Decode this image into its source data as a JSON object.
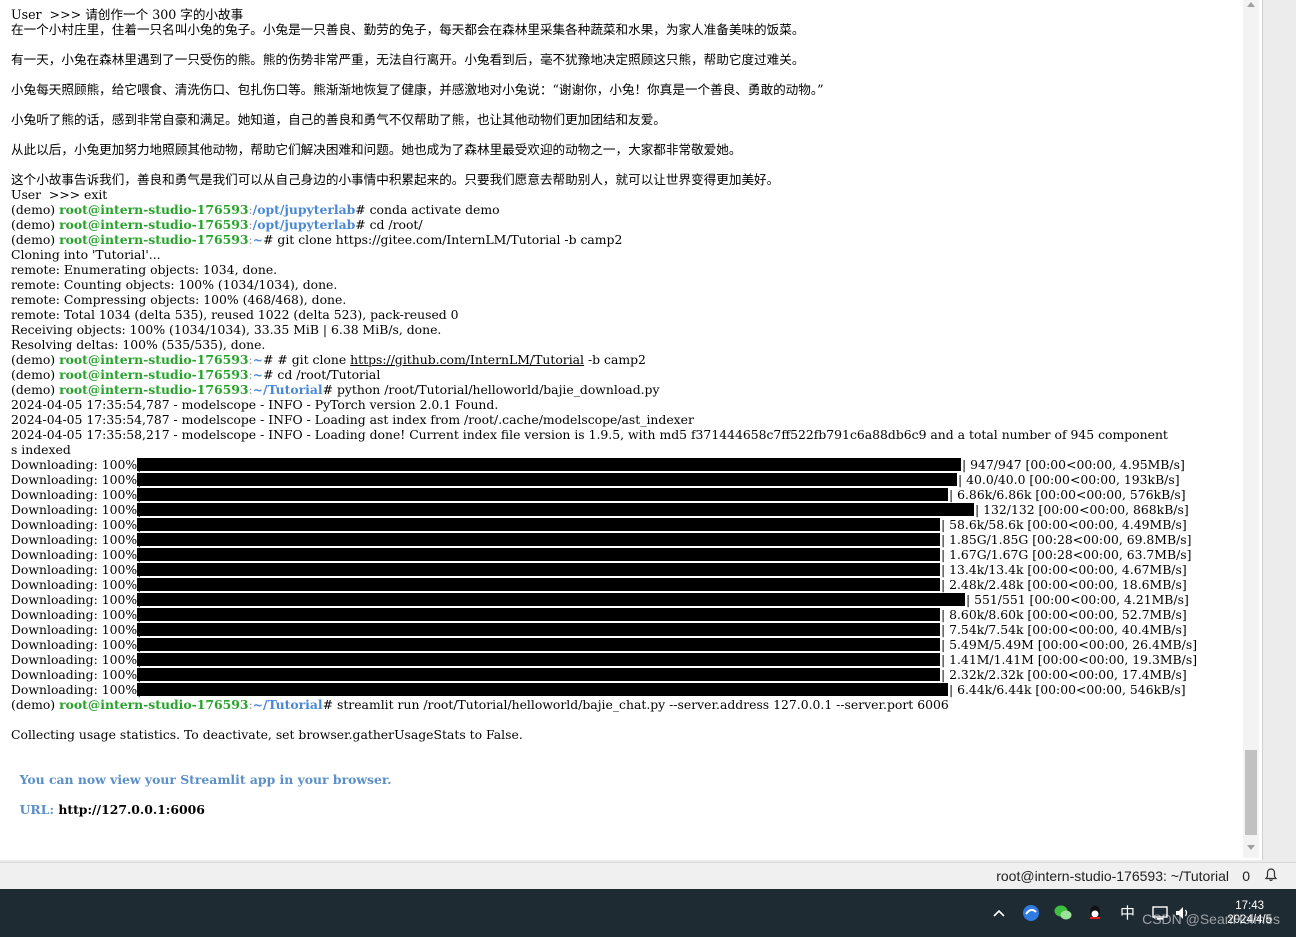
{
  "terminal": {
    "lines": [
      {
        "t": "plain",
        "text": "User  >>> 请创作一个 300 字的小故事"
      },
      {
        "t": "plain",
        "text": "在一个小村庄里，住着一只名叫小兔的兔子。小兔是一只善良、勤劳的兔子，每天都会在森林里采集各种蔬菜和水果，为家人准备美味的饭菜。"
      },
      {
        "t": "plain",
        "text": ""
      },
      {
        "t": "plain",
        "text": "有一天，小兔在森林里遇到了一只受伤的熊。熊的伤势非常严重，无法自行离开。小兔看到后，毫不犹豫地决定照顾这只熊，帮助它度过难关。"
      },
      {
        "t": "plain",
        "text": ""
      },
      {
        "t": "plain",
        "text": "小兔每天照顾熊，给它喂食、清洗伤口、包扎伤口等。熊渐渐地恢复了健康，并感激地对小兔说：“谢谢你，小兔！你真是一个善良、勇敢的动物。”"
      },
      {
        "t": "plain",
        "text": ""
      },
      {
        "t": "plain",
        "text": "小兔听了熊的话，感到非常自豪和满足。她知道，自己的善良和勇气不仅帮助了熊，也让其他动物们更加团结和友爱。"
      },
      {
        "t": "plain",
        "text": ""
      },
      {
        "t": "plain",
        "text": "从此以后，小兔更加努力地照顾其他动物，帮助它们解决困难和问题。她也成为了森林里最受欢迎的动物之一，大家都非常敬爱她。"
      },
      {
        "t": "plain",
        "text": ""
      },
      {
        "t": "plain",
        "text": "这个小故事告诉我们，善良和勇气是我们可以从自己身边的小事情中积累起来的。只要我们愿意去帮助别人，就可以让世界变得更加美好。"
      },
      {
        "t": "plain",
        "text": "User  >>> exit"
      },
      {
        "t": "prompt",
        "env": "(demo) ",
        "host": "root@intern-studio-176593",
        "path": "/opt/jupyterlab",
        "cmd": "# conda activate demo"
      },
      {
        "t": "prompt",
        "env": "(demo) ",
        "host": "root@intern-studio-176593",
        "path": "/opt/jupyterlab",
        "cmd": "# cd /root/"
      },
      {
        "t": "prompt",
        "env": "(demo) ",
        "host": "root@intern-studio-176593",
        "path": "~",
        "cmd": "# git clone https://gitee.com/InternLM/Tutorial -b camp2"
      },
      {
        "t": "plain",
        "text": "Cloning into 'Tutorial'..."
      },
      {
        "t": "plain",
        "text": "remote: Enumerating objects: 1034, done."
      },
      {
        "t": "plain",
        "text": "remote: Counting objects: 100% (1034/1034), done."
      },
      {
        "t": "plain",
        "text": "remote: Compressing objects: 100% (468/468), done."
      },
      {
        "t": "plain",
        "text": "remote: Total 1034 (delta 535), reused 1022 (delta 523), pack-reused 0"
      },
      {
        "t": "plain",
        "text": "Receiving objects: 100% (1034/1034), 33.35 MiB | 6.38 MiB/s, done."
      },
      {
        "t": "plain",
        "text": "Resolving deltas: 100% (535/535), done."
      },
      {
        "t": "prompt_url",
        "env": "(demo) ",
        "host": "root@intern-studio-176593",
        "path": "~",
        "pre": "# # git clone ",
        "url": "https://github.com/InternLM/Tutorial",
        "post": " -b camp2"
      },
      {
        "t": "prompt",
        "env": "(demo) ",
        "host": "root@intern-studio-176593",
        "path": "~",
        "cmd": "# cd /root/Tutorial"
      },
      {
        "t": "prompt",
        "env": "(demo) ",
        "host": "root@intern-studio-176593",
        "path": "~/Tutorial",
        "cmd": "# python /root/Tutorial/helloworld/bajie_download.py"
      },
      {
        "t": "plain",
        "text": "2024-04-05 17:35:54,787 - modelscope - INFO - PyTorch version 2.0.1 Found."
      },
      {
        "t": "plain",
        "text": "2024-04-05 17:35:54,787 - modelscope - INFO - Loading ast index from /root/.cache/modelscope/ast_indexer"
      },
      {
        "t": "plain",
        "text": "2024-04-05 17:35:58,217 - modelscope - INFO - Loading done! Current index file version is 1.9.5, with md5 f371444658c7ff522fb791c6a88db6c9 and a total number of 945 component"
      },
      {
        "t": "plain",
        "text": "s indexed"
      }
    ],
    "downloads": [
      {
        "label": "Downloading: 100%|",
        "stats": "| 947/947 [00:00<00:00, 4.95MB/s]",
        "fill": 0.955
      },
      {
        "label": "Downloading: 100%|",
        "stats": "| 40.0/40.0 [00:00<00:00, 193kB/s]",
        "fill": 0.95
      },
      {
        "label": "Downloading: 100%|",
        "stats": "| 6.86k/6.86k [00:00<00:00, 576kB/s]",
        "fill": 0.94
      },
      {
        "label": "Downloading: 100%|",
        "stats": "| 132/132 [00:00<00:00, 868kB/s]",
        "fill": 0.97
      },
      {
        "label": "Downloading: 100%|",
        "stats": "| 58.6k/58.6k [00:00<00:00, 4.49MB/s]",
        "fill": 0.93
      },
      {
        "label": "Downloading: 100%|",
        "stats": "| 1.85G/1.85G [00:28<00:00, 69.8MB/s]",
        "fill": 0.93
      },
      {
        "label": "Downloading: 100%|",
        "stats": "| 1.67G/1.67G [00:28<00:00, 63.7MB/s]",
        "fill": 0.93
      },
      {
        "label": "Downloading: 100%|",
        "stats": "| 13.4k/13.4k [00:00<00:00, 4.67MB/s]",
        "fill": 0.93
      },
      {
        "label": "Downloading: 100%|",
        "stats": "| 2.48k/2.48k [00:00<00:00, 18.6MB/s]",
        "fill": 0.93
      },
      {
        "label": "Downloading: 100%|",
        "stats": "| 551/551 [00:00<00:00, 4.21MB/s]",
        "fill": 0.96
      },
      {
        "label": "Downloading: 100%|",
        "stats": "| 8.60k/8.60k [00:00<00:00, 52.7MB/s]",
        "fill": 0.93
      },
      {
        "label": "Downloading: 100%|",
        "stats": "| 7.54k/7.54k [00:00<00:00, 40.4MB/s]",
        "fill": 0.93
      },
      {
        "label": "Downloading: 100%|",
        "stats": "| 5.49M/5.49M [00:00<00:00, 26.4MB/s]",
        "fill": 0.93
      },
      {
        "label": "Downloading: 100%|",
        "stats": "| 1.41M/1.41M [00:00<00:00, 19.3MB/s]",
        "fill": 0.93
      },
      {
        "label": "Downloading: 100%|",
        "stats": "| 2.32k/2.32k [00:00<00:00, 17.4MB/s]",
        "fill": 0.93
      },
      {
        "label": "Downloading: 100%|",
        "stats": "| 6.44k/6.44k [00:00<00:00, 546kB/s]",
        "fill": 0.94
      }
    ],
    "after": [
      {
        "t": "prompt",
        "env": "(demo) ",
        "host": "root@intern-studio-176593",
        "path": "~/Tutorial",
        "cmd": "# streamlit run /root/Tutorial/helloworld/bajie_chat.py --server.address 127.0.0.1 --server.port 6006"
      },
      {
        "t": "plain",
        "text": ""
      },
      {
        "t": "plain",
        "text": "Collecting usage statistics. To deactivate, set browser.gatherUsageStats to False."
      },
      {
        "t": "plain",
        "text": ""
      },
      {
        "t": "plain",
        "text": ""
      },
      {
        "t": "blue",
        "text": "  You can now view your Streamlit app in your browser."
      },
      {
        "t": "plain",
        "text": ""
      },
      {
        "t": "url",
        "label": "  URL: ",
        "url": "http://127.0.0.1:6006"
      }
    ]
  },
  "statusbar": {
    "title": "root@intern-studio-176593: ~/Tutorial",
    "count": "0",
    "bell_icon": "bell-icon"
  },
  "taskbar": {
    "ime": "中",
    "time": "17:43",
    "date": "2024/4/5",
    "watermark": "CSDN @SeanHolmes",
    "tray_icons": [
      "chevron-up-icon",
      "browser-icon",
      "wechat-icon",
      "qq-icon",
      "network-icon",
      "volume-icon"
    ]
  }
}
